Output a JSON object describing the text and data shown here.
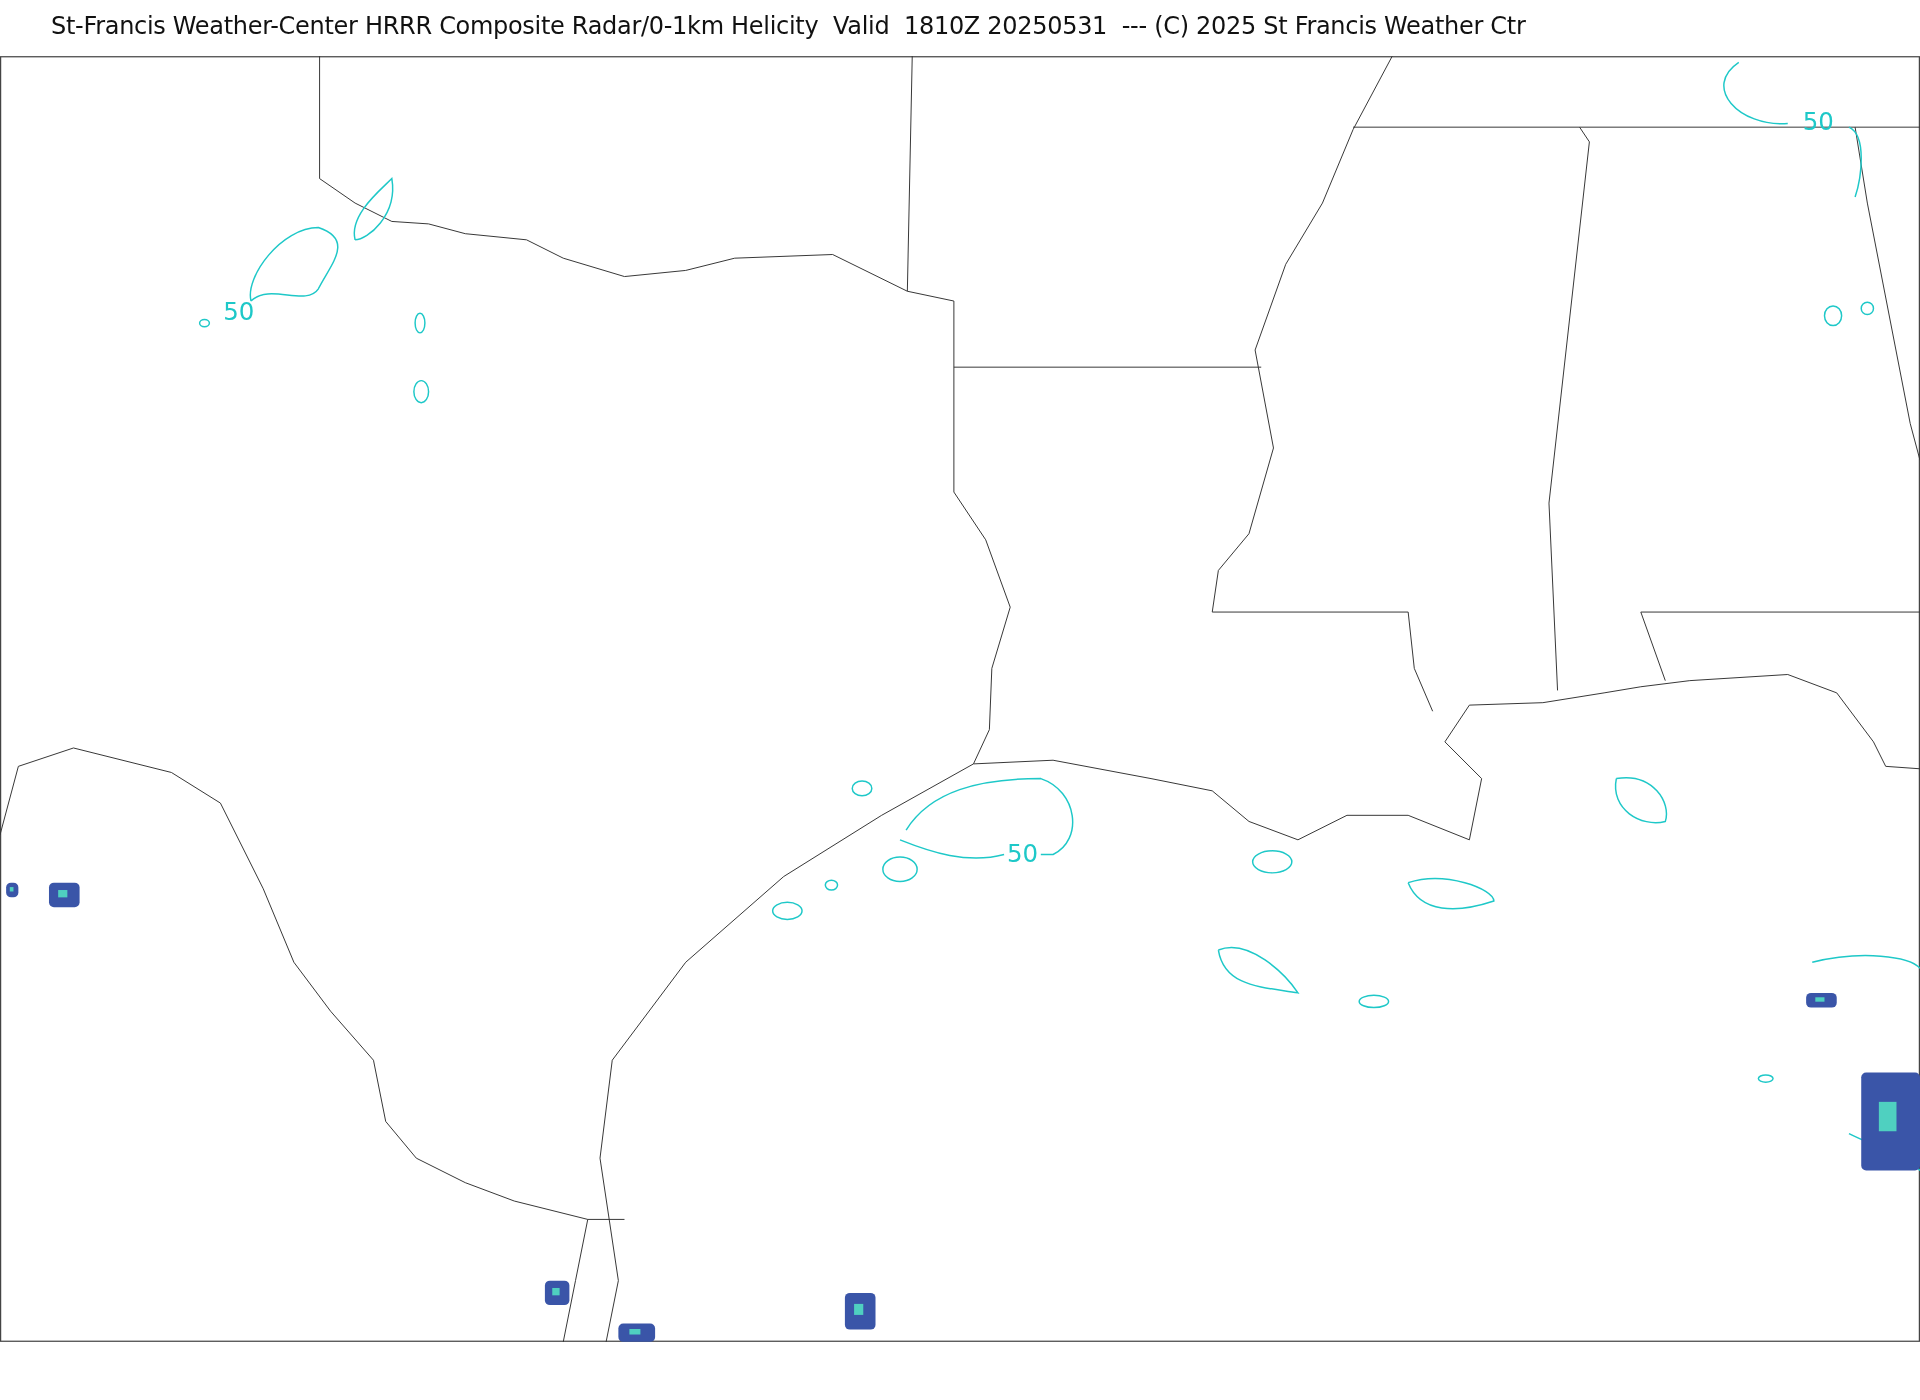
{
  "title": "St-Francis Weather-Center HRRR Composite Radar/0-1km Helicity  Valid  1810Z 20250531  --- (C) 2025 St Francis Weather Ctr",
  "map": {
    "contour_labels": [
      {
        "text": "50",
        "kind": "helicity"
      },
      {
        "text": "50",
        "kind": "helicity"
      },
      {
        "text": "50",
        "kind": "helicity"
      }
    ]
  }
}
